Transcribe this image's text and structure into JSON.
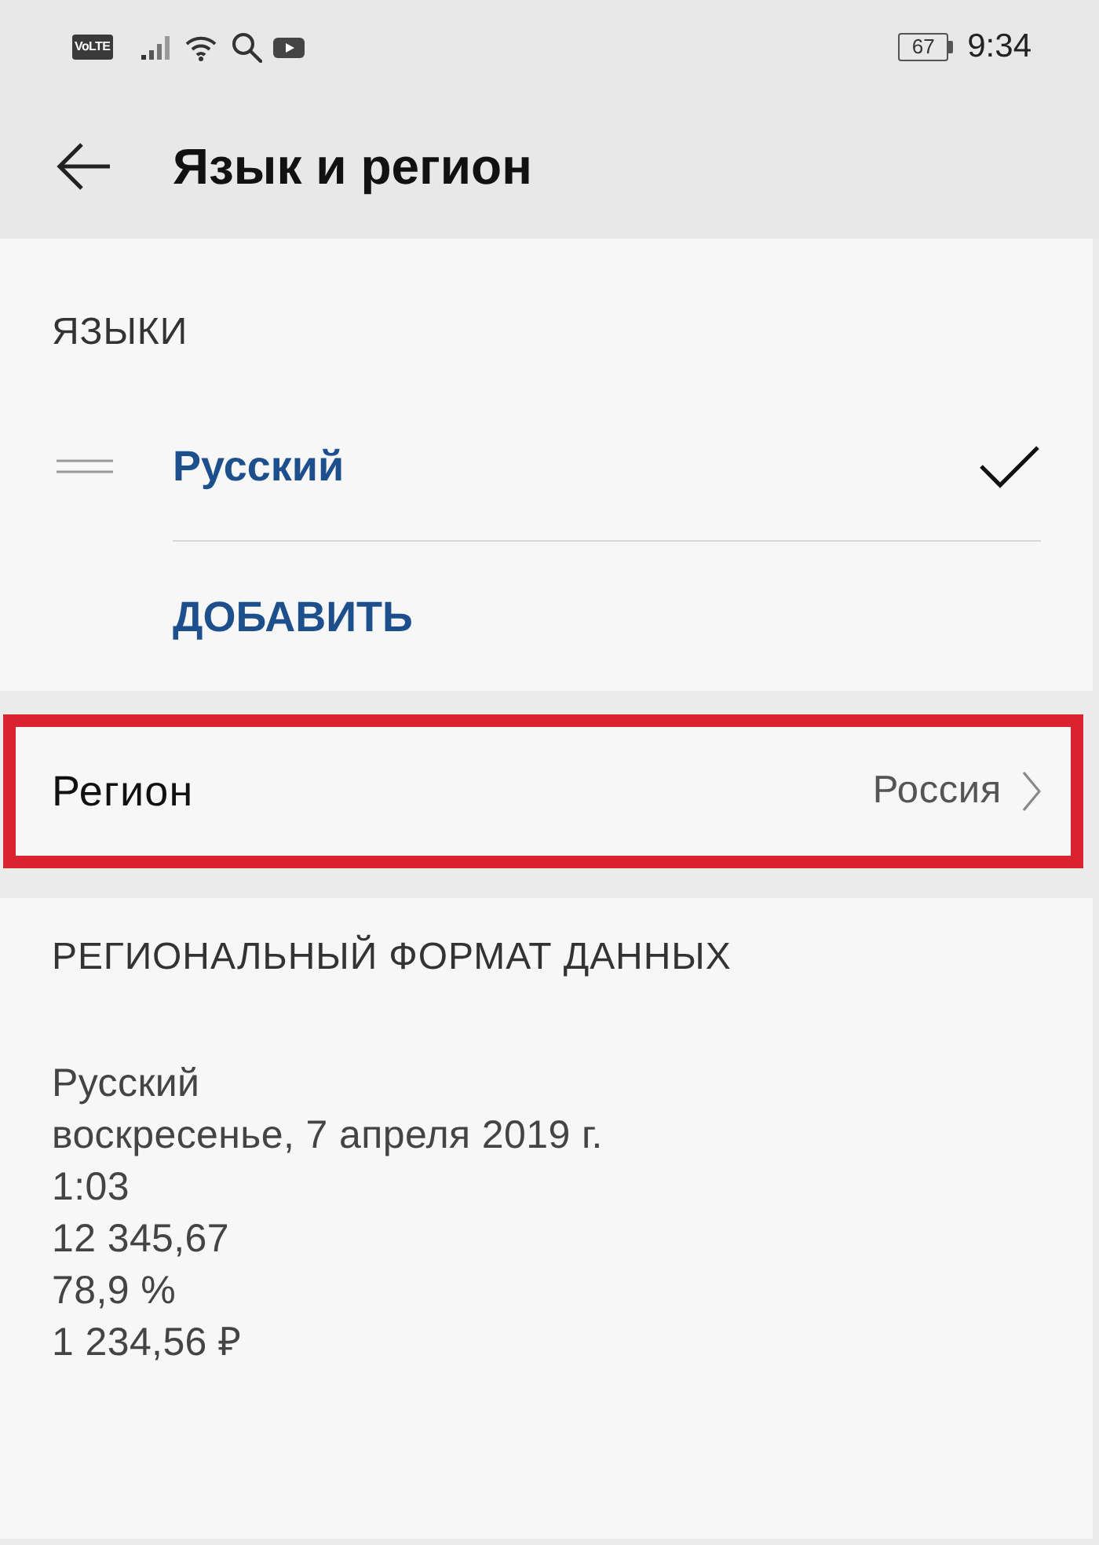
{
  "status_bar": {
    "network_badge": "VoLTE",
    "battery": "67",
    "time": "9:34"
  },
  "header": {
    "title": "Язык и регион"
  },
  "languages": {
    "heading": "ЯЗЫКИ",
    "items": [
      {
        "name": "Русский",
        "selected": true
      }
    ],
    "add_label": "ДОБАВИТЬ"
  },
  "region": {
    "label": "Регион",
    "value": "Россия",
    "highlighted": true
  },
  "regional_format": {
    "heading": "РЕГИОНАЛЬНЫЙ ФОРМАТ ДАННЫХ",
    "examples": [
      "Русский",
      "воскресенье, 7 апреля 2019 г.",
      "1:03",
      "12 345,67",
      "78,9 %",
      "1 234,56 ₽"
    ]
  }
}
